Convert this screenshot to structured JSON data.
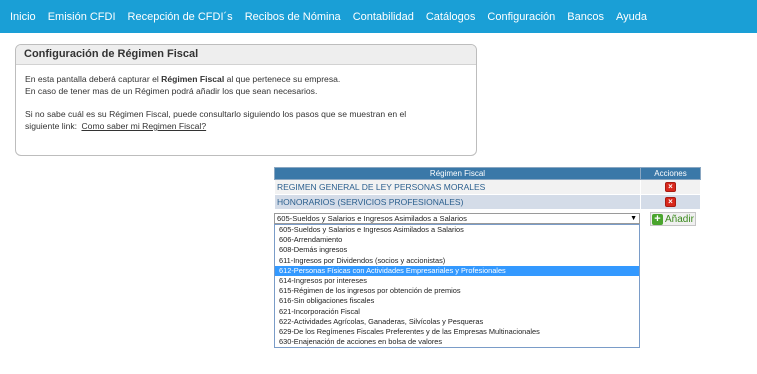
{
  "nav": [
    "Inicio",
    "Emisión CFDI",
    "Recepción de CFDI´s",
    "Recibos de Nómina",
    "Contabilidad",
    "Catálogos",
    "Configuración",
    "Bancos",
    "Ayuda"
  ],
  "panel": {
    "title": "Configuración de Régimen Fiscal",
    "line1_pre": "En esta pantalla deberá capturar el ",
    "line1_bold": "Régimen Fiscal",
    "line1_post": " al que pertenece su empresa.",
    "line2": "En caso de tener mas de un Régimen podrá añadir los que sean necesarios.",
    "line3": "Si no sabe cuál es su Régimen Fiscal, puede consultarlo siguiendo los pasos que se muestran en el",
    "line4_pre": "siguiente link:",
    "link": "Como saber mi Regimen Fiscal?"
  },
  "table": {
    "col_regimen": "Régimen Fiscal",
    "col_acciones": "Acciones",
    "rows": [
      "REGIMEN GENERAL DE LEY PERSONAS MORALES",
      "HONORARIOS (SERVICIOS PROFESIONALES)"
    ],
    "delete_glyph": "×"
  },
  "select": {
    "value": "605-Sueldos y Salarios e Ingresos Asimilados a Salarios",
    "caret": "▼"
  },
  "add_button": {
    "plus": "+",
    "label": "Añadir"
  },
  "options": [
    "605-Sueldos y Salarios e Ingresos Asimilados a Salarios",
    "606-Arrendamiento",
    "608-Demás ingresos",
    "611-Ingresos por Dividendos (socios y accionistas)",
    "612-Personas Físicas con Actividades Empresariales y Profesionales",
    "614-Ingresos por intereses",
    "615-Régimen de los ingresos por obtención de premios",
    "616-Sin obligaciones fiscales",
    "621-Incorporación Fiscal",
    "622-Actividades Agrícolas, Ganaderas, Silvícolas y Pesqueras",
    "629-De los Regímenes Fiscales Preferentes y de las Empresas Multinacionales",
    "630-Enajenación de acciones en bolsa de valores"
  ],
  "selected_option": "612-Personas Físicas con Actividades Empresariales y Profesionales",
  "colors": {
    "nav": "#1a9fd6",
    "table_header": "#3a78a8",
    "highlight": "#3399ff",
    "delete": "#d8281c",
    "add": "#4aa52e"
  }
}
